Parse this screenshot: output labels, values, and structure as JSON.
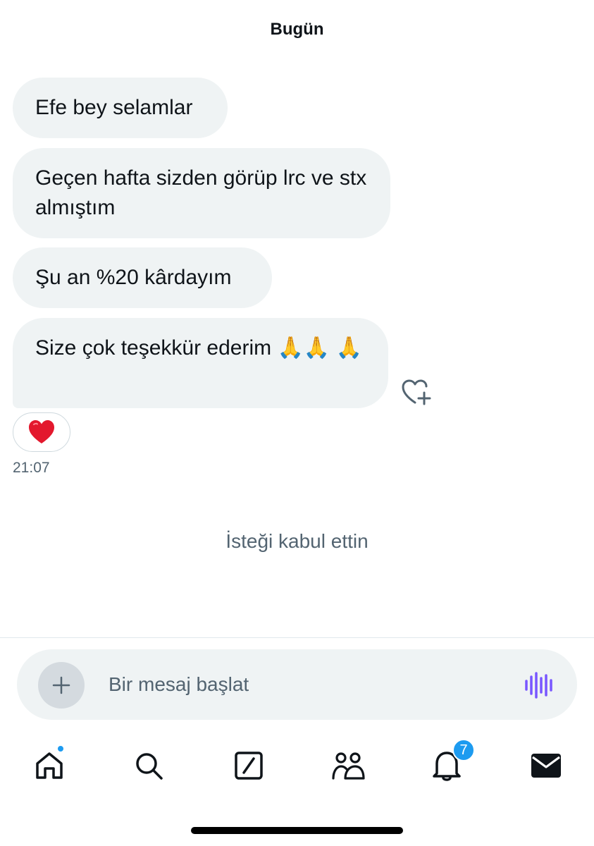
{
  "header": {
    "date_label": "Bugün"
  },
  "messages": [
    {
      "text": "Efe bey selamlar"
    },
    {
      "text": "Geçen hafta sizden görüp lrc ve stx almıştım"
    },
    {
      "text": "Şu an %20 kârdayım"
    },
    {
      "text": "Size çok teşekkür ederim 🙏🙏 🙏"
    }
  ],
  "reaction": {
    "emoji": "❤️"
  },
  "timestamp": "21:07",
  "system_note": "İsteği kabul ettin",
  "composer": {
    "placeholder": "Bir mesaj başlat",
    "value": ""
  },
  "tabbar": {
    "icons": [
      "home-icon",
      "search-icon",
      "grok-icon",
      "communities-icon",
      "bell-icon",
      "mail-icon"
    ],
    "notifications_count": "7"
  },
  "colors": {
    "accent": "#1d9bf0",
    "bubble": "#eff3f4",
    "voice": "#7856ff",
    "muted": "#536471"
  }
}
